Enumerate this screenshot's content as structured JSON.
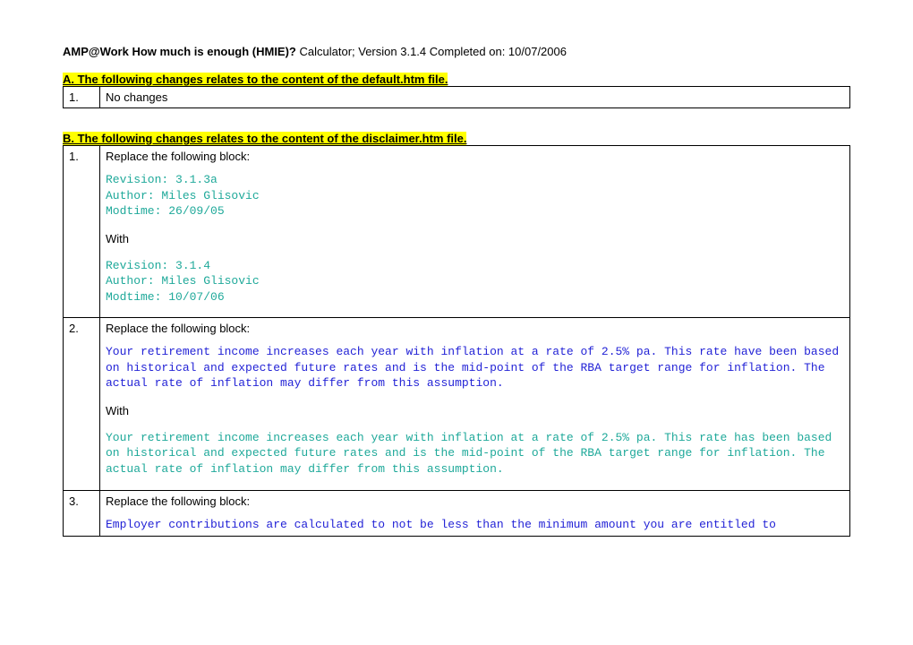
{
  "header": {
    "title_bold": "AMP@Work How much is enough (HMIE)?",
    "title_rest": " Calculator; Version 3.1.4 Completed on: 10/07/2006"
  },
  "sectionA": {
    "heading": "A. The following changes relates to the content of the default.htm file.",
    "rows": [
      {
        "num": "1.",
        "text": "No changes"
      }
    ]
  },
  "sectionB": {
    "heading": "B. The following changes relates to the content of the disclaimer.htm file.",
    "rows": [
      {
        "num": "1.",
        "lead": "Replace the following block:",
        "old1": "Revision: 3.1.3a",
        "old2": "Author: Miles Glisovic",
        "old3": "Modtime: 26/09/05",
        "with": "With",
        "new1": "Revision: 3.1.4",
        "new2": "Author: Miles Glisovic",
        "new3": "Modtime: 10/07/06"
      },
      {
        "num": "2.",
        "lead": "Replace the following block:",
        "old": "Your retirement income increases each year with inflation at a rate of 2.5% pa. This rate have been based on historical and expected future rates and is the mid-point of the RBA target range for inflation. The actual rate of inflation may differ from this assumption.",
        "with": "With",
        "new": "Your retirement income increases each year with inflation at a rate of 2.5% pa. This rate has been based on historical and expected future rates and is the mid-point of the RBA target range for inflation. The actual rate of inflation may differ from this assumption."
      },
      {
        "num": "3.",
        "lead": "Replace the following block:",
        "old": "Employer contributions are calculated to not be less than the minimum amount you are entitled to"
      }
    ]
  }
}
